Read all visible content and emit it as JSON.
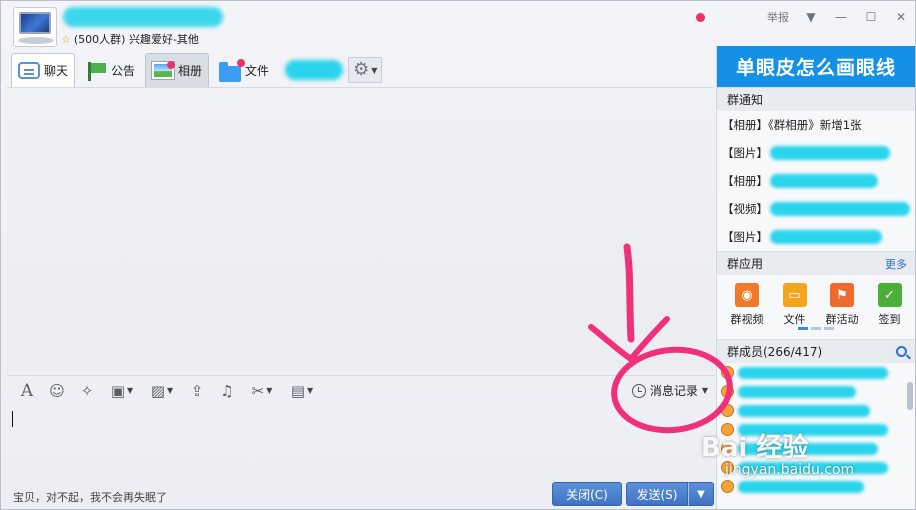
{
  "group": {
    "subtitle": "(500人群) 兴趣爱好-其他"
  },
  "title_controls": {
    "report_label": "举报"
  },
  "tabs": [
    {
      "label": "聊天"
    },
    {
      "label": "公告"
    },
    {
      "label": "相册"
    },
    {
      "label": "文件"
    }
  ],
  "toolbar": {
    "history_label": "消息记录"
  },
  "footer": {
    "signature": "宝贝，对不起，我不会再失眠了",
    "close_label": "关闭(C)",
    "send_label": "发送(S)"
  },
  "side": {
    "banner": "单眼皮怎么画眼线",
    "notice_title": "群通知",
    "notices": [
      {
        "text": "【相册】《群相册》新增1张"
      },
      {
        "text": "【图片】"
      },
      {
        "text": "【相册】"
      },
      {
        "text": "【视频】"
      },
      {
        "text": "【图片】"
      }
    ],
    "apps_title": "群应用",
    "apps_more": "更多",
    "apps": [
      {
        "label": "群视频",
        "icon": "video-icon",
        "color": "#f07a2a"
      },
      {
        "label": "文件",
        "icon": "folder-icon",
        "color": "#f4a51c"
      },
      {
        "label": "群活动",
        "icon": "activity-icon",
        "color": "#ef6a2d"
      },
      {
        "label": "签到",
        "icon": "checkin-icon",
        "color": "#4caf3a"
      }
    ],
    "members_title": "群成员(266/417)"
  },
  "watermark": {
    "main": "Bai 经验",
    "sub": "jingyan.baidu.com"
  },
  "colors": {
    "accent": "#1491e6",
    "annotation": "#f0307a",
    "blur": "#2ad4ec"
  }
}
